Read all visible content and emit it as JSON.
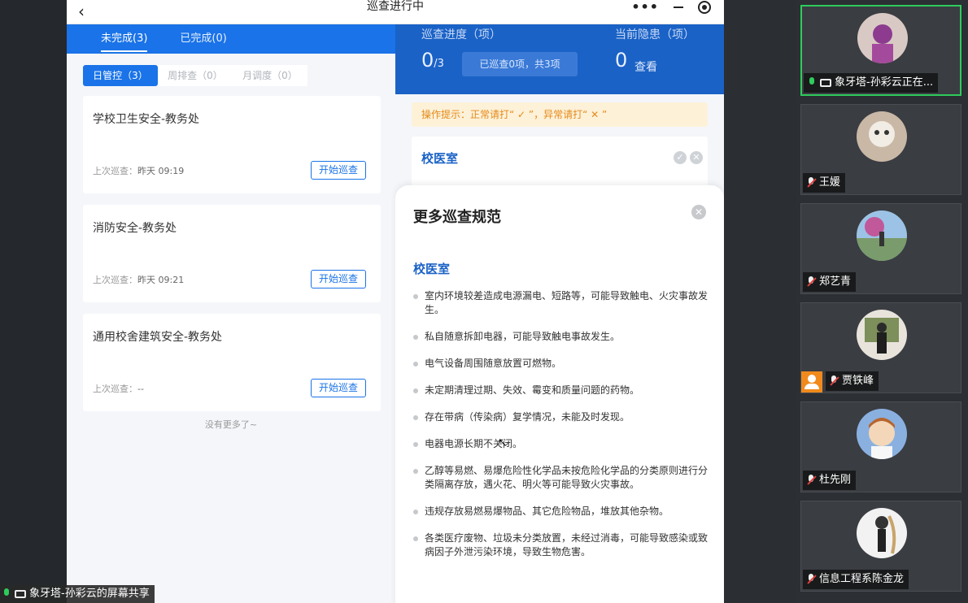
{
  "app": {
    "title": "巡查进行中",
    "back_icon": "chevron-left-icon",
    "more_icon": "more-dots-icon",
    "minimize_icon": "minimize-icon",
    "record_icon": "target-icon"
  },
  "tabs": [
    {
      "label": "未完成(3)",
      "active": true
    },
    {
      "label": "已完成(0)",
      "active": false
    }
  ],
  "subtabs": [
    {
      "label": "日管控（3）",
      "active": true
    },
    {
      "label": "周排查（0）",
      "active": false
    },
    {
      "label": "月调度（0）",
      "active": false
    }
  ],
  "cards": [
    {
      "name": "学校卫生安全-教务处",
      "last_label": "上次巡查：",
      "last_value": "昨天 09:19",
      "button": "开始巡查"
    },
    {
      "name": "消防安全-教务处",
      "last_label": "上次巡查：",
      "last_value": "昨天 09:21",
      "button": "开始巡查"
    },
    {
      "name": "通用校舍建筑安全-教务处",
      "last_label": "上次巡查：",
      "last_value": "--",
      "button": "开始巡查"
    }
  ],
  "no_more": "没有更多了~",
  "progress": {
    "label": "巡查进度（项）",
    "value": "0",
    "total": "/3",
    "pill": "已巡查0项，共3项",
    "hazard_label": "当前隐患（项）",
    "hazard_value": "0",
    "hazard_link": "查看"
  },
  "tip": "操作提示：正常请打“ ✓ ”，异常请打“ ✕ ”",
  "room": {
    "title": "校医室",
    "ok_icon": "check-icon",
    "no_icon": "cross-icon"
  },
  "modal": {
    "title": "更多巡查规范",
    "close_icon": "close-icon",
    "section": "校医室",
    "rules": [
      "室内环境较差造成电源漏电、短路等，可能导致触电、火灾事故发生。",
      "私自随意拆卸电器，可能导致触电事故发生。",
      "电气设备周围随意放置可燃物。",
      "未定期清理过期、失效、霉变和质量问题的药物。",
      "存在带病（传染病）复学情况，未能及时发现。",
      "电器电源长期不关闭。",
      "乙醇等易燃、易爆危险性化学品未按危险化学品的分类原则进行分类隔离存放，遇火花、明火等可能导致火灾事故。",
      "违规存放易燃易爆物品、其它危险物品，堆放其他杂物。",
      "各类医疗废物、垃圾未分类放置，未经过消毒，可能导致感染或致病因子外泄污染环境，导致生物危害。"
    ]
  },
  "participants": [
    {
      "name": "象牙塔-孙彩云正在...",
      "mic": "on",
      "sharing": true,
      "active": true
    },
    {
      "name": "王媛",
      "mic": "muted"
    },
    {
      "name": "郑艺青",
      "mic": "muted"
    },
    {
      "name": "贾铁峰",
      "mic": "muted",
      "host_icon": "person-icon"
    },
    {
      "name": "杜先刚",
      "mic": "muted"
    },
    {
      "name": "信息工程系陈金龙",
      "mic": "muted"
    }
  ],
  "share_label": "象牙塔-孙彩云的屏幕共享",
  "colors": {
    "accent": "#1a73e8",
    "header_blue": "#1a62c6",
    "tip_orange": "#e58a1a",
    "speaking_green": "#2ecc5b"
  }
}
